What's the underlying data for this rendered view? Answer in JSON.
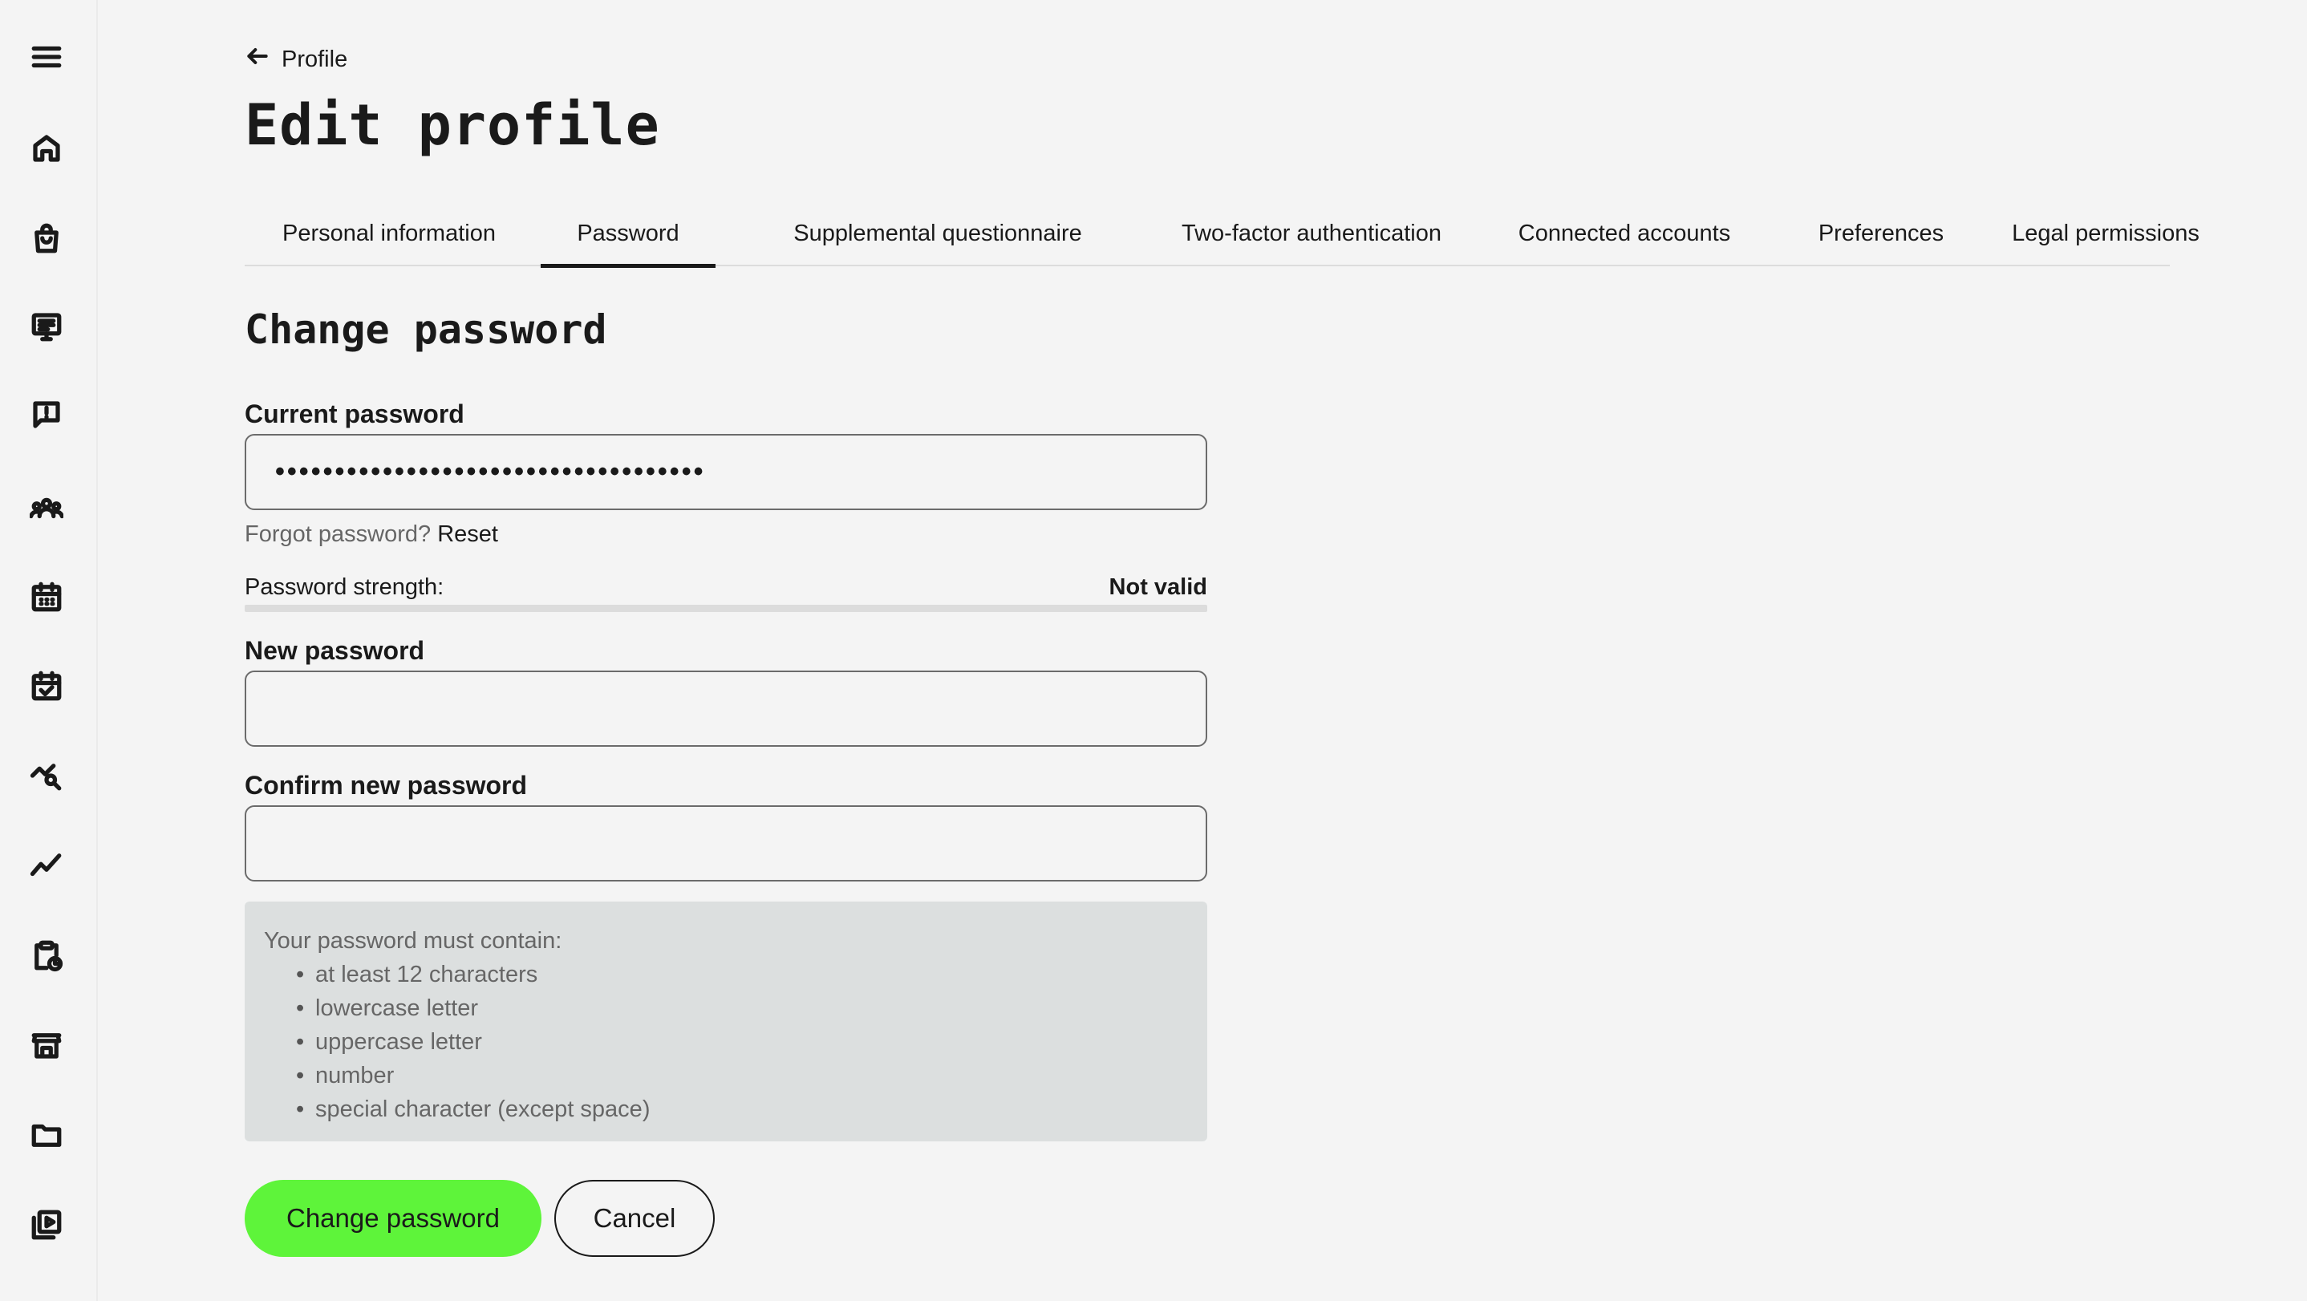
{
  "sidebar": {
    "icons": [
      "menu-icon",
      "home-icon",
      "shopping-bag-icon",
      "monitor-list-icon",
      "alert-message-icon",
      "team-icon",
      "calendar-icon",
      "calendar-check-icon",
      "search-chart-icon",
      "trend-line-icon",
      "clipboard-clock-icon",
      "store-icon",
      "folder-icon",
      "video-library-icon"
    ]
  },
  "header": {
    "back_label": "Profile",
    "title": "Edit profile"
  },
  "tabs": [
    {
      "label": "Personal information",
      "active": false
    },
    {
      "label": "Password",
      "active": true
    },
    {
      "label": "Supplemental questionnaire",
      "active": false
    },
    {
      "label": "Two-factor authentication",
      "active": false
    },
    {
      "label": "Connected accounts",
      "active": false
    },
    {
      "label": "Preferences",
      "active": false
    },
    {
      "label": "Legal permissions",
      "active": false
    }
  ],
  "form": {
    "section_title": "Change password",
    "current_password": {
      "label": "Current password",
      "value": "••••••••••••••••••••••••••••••••••••"
    },
    "forgot_text": "Forgot password?",
    "reset_link": "Reset",
    "strength": {
      "label": "Password strength:",
      "value": "Not valid",
      "level": 0
    },
    "new_password": {
      "label": "New password",
      "value": ""
    },
    "confirm_password": {
      "label": "Confirm new password",
      "value": ""
    },
    "requirements": {
      "heading": "Your password must contain:",
      "items": [
        "at least 12 characters",
        "lowercase letter",
        "uppercase letter",
        "number",
        "special character (except space)"
      ]
    },
    "submit_label": "Change password",
    "cancel_label": "Cancel"
  },
  "colors": {
    "accent": "#5ef43a",
    "background": "#f4f4f4",
    "requirements_bg": "#dcdfdf"
  }
}
